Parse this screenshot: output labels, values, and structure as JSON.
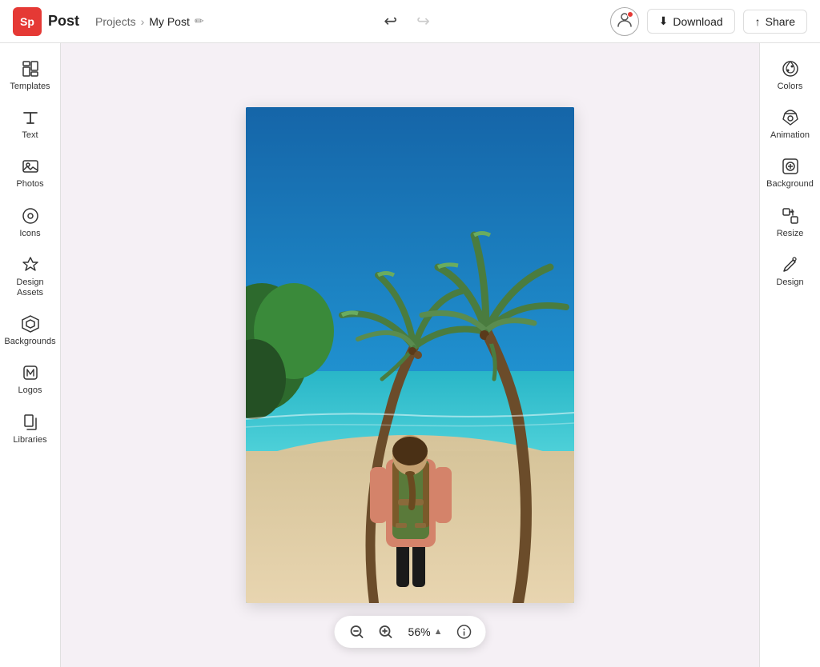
{
  "app": {
    "logo_text": "Sp",
    "name": "Post"
  },
  "breadcrumb": {
    "parent": "Projects",
    "separator": "›",
    "current": "My Post",
    "edit_icon": "✏"
  },
  "header": {
    "undo_icon": "↩",
    "redo_icon": "↪",
    "avatar_icon": "👤",
    "download_icon": "⬇",
    "download_label": "Download",
    "share_icon": "↑",
    "share_label": "Share"
  },
  "left_sidebar": {
    "items": [
      {
        "id": "templates",
        "label": "Templates",
        "icon": "⊞"
      },
      {
        "id": "text",
        "label": "Text",
        "icon": "T"
      },
      {
        "id": "photos",
        "label": "Photos",
        "icon": "🖼"
      },
      {
        "id": "icons",
        "label": "Icons",
        "icon": "◯"
      },
      {
        "id": "design-assets",
        "label": "Design Assets",
        "icon": "◇"
      },
      {
        "id": "backgrounds",
        "label": "Backgrounds",
        "icon": "⬡"
      },
      {
        "id": "logos",
        "label": "Logos",
        "icon": "B"
      },
      {
        "id": "libraries",
        "label": "Libraries",
        "icon": "📄"
      }
    ]
  },
  "right_sidebar": {
    "items": [
      {
        "id": "colors",
        "label": "Colors",
        "icon": "🎨"
      },
      {
        "id": "animation",
        "label": "Animation",
        "icon": "✦"
      },
      {
        "id": "background",
        "label": "Background",
        "icon": "⊗"
      },
      {
        "id": "resize",
        "label": "Resize",
        "icon": "⤢"
      },
      {
        "id": "design",
        "label": "Design",
        "icon": "✏"
      }
    ]
  },
  "zoom": {
    "zoom_out_icon": "−",
    "zoom_in_icon": "+",
    "value": "56%",
    "chevron": "▲",
    "info_icon": "ⓘ"
  }
}
